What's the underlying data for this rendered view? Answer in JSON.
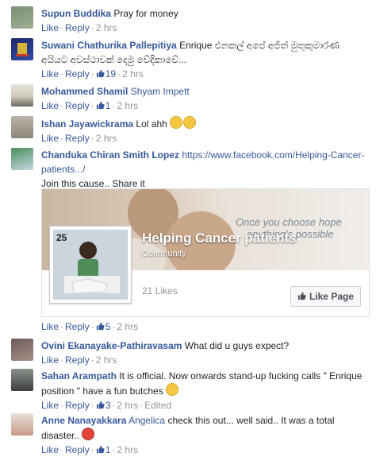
{
  "comments": [
    {
      "name": "Supun Buddika",
      "text": "Pray for money",
      "actions": {
        "like": "Like",
        "reply": "Reply",
        "likes": "",
        "time": "2 hrs"
      }
    },
    {
      "name": "Suwani Chathurika Pallepitiya",
      "text": "Enrique එනකල් අපේ අජිත් මුතුකුමාරණ අයියට අවස්ථාවක් දෙමු වේදිකාවේ...",
      "actions": {
        "like": "Like",
        "reply": "Reply",
        "likes": "19",
        "time": "2 hrs"
      }
    },
    {
      "name": "Mohammed Shamil",
      "mention": "Shyam Impett",
      "actions": {
        "like": "Like",
        "reply": "Reply",
        "likes": "1",
        "time": "2 hrs"
      }
    },
    {
      "name": "Ishan Jayawickrama",
      "text": "Lol ahh",
      "actions": {
        "like": "Like",
        "reply": "Reply",
        "likes": "",
        "time": "2 hrs"
      }
    },
    {
      "name": "Chanduka Chiran Smith Lopez",
      "link": "https://www.facebook.com/Helping-Cancer-patients.../",
      "text": "Join this cause.. Share it",
      "actions": {
        "like": "Like",
        "reply": "Reply",
        "likes": "5",
        "time": "2 hrs"
      }
    },
    {
      "name": "Ovini Ekanayake-Pathiravasam",
      "text": "What did u guys expect?",
      "actions": {
        "like": "Like",
        "reply": "Reply",
        "likes": "",
        "time": "2 hrs"
      }
    },
    {
      "name": "Sahan Arampath",
      "text": "It is official. Now onwards stand-up fucking calls \" Enrique position \" have a fun butches",
      "actions": {
        "like": "Like",
        "reply": "Reply",
        "likes": "3",
        "time": "2 hrs",
        "edited": "Edited"
      }
    },
    {
      "name": "Anne Nanayakkara",
      "mention": "Angelica",
      "text": "check this out... well said.. It was a total disaster..",
      "actions": {
        "like": "Like",
        "reply": "Reply",
        "likes": "1",
        "time": "2 hrs"
      }
    }
  ],
  "card": {
    "title": "Helping Cancer patients",
    "subtitle": "Community",
    "slogan_line1": "Once you choose hope",
    "slogan_line2": "anything's possible",
    "likes": "21 Likes",
    "like_page_button": "Like Page",
    "thumb_number": "25"
  },
  "colors": {
    "link": "#365899",
    "meta": "#90949c",
    "text": "#1d2129"
  }
}
